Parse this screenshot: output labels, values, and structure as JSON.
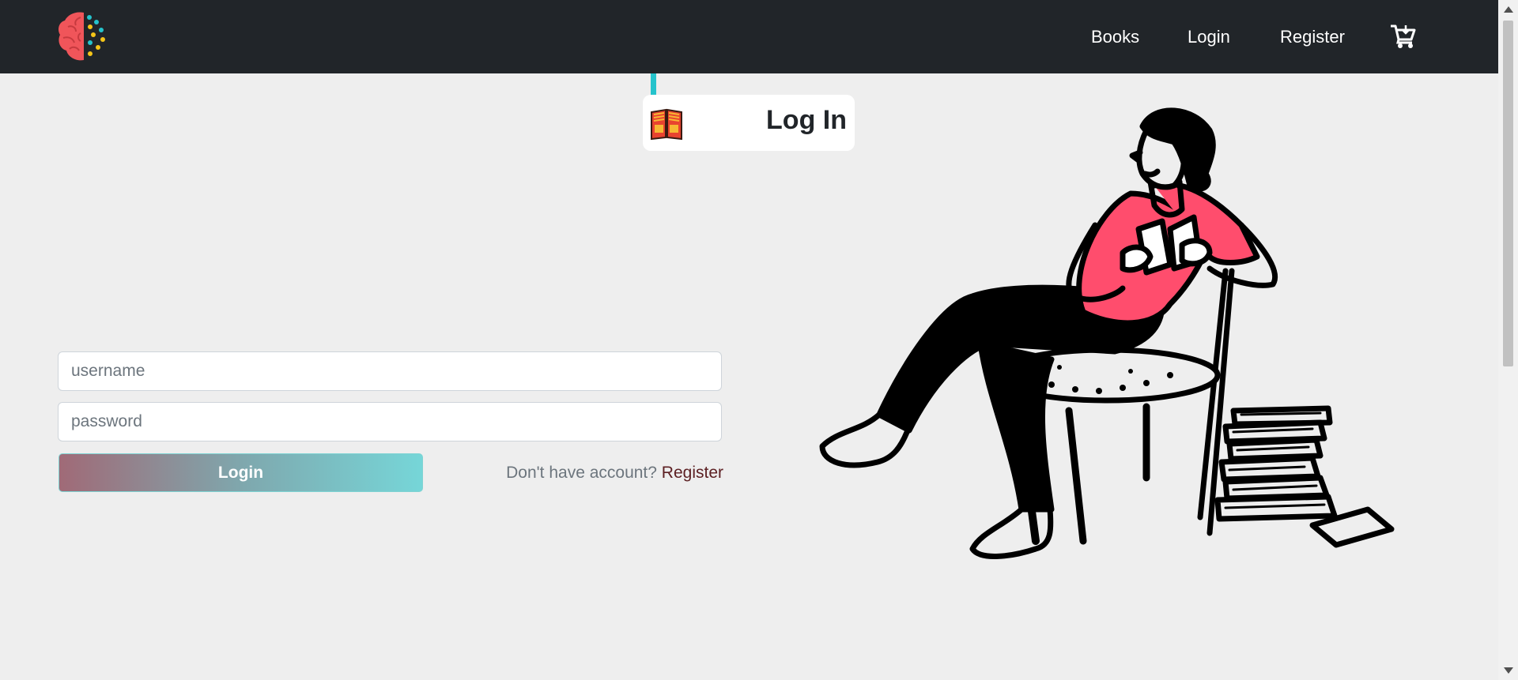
{
  "nav": {
    "logo_icon": "brain-logo-icon",
    "links": [
      "Books",
      "Login",
      "Register"
    ],
    "cart_icon": "shopping-cart-icon"
  },
  "hero": {
    "title": "Log In",
    "icon": "open-book-icon",
    "accent_color": "#25c3cc"
  },
  "form": {
    "username_placeholder": "username",
    "password_placeholder": "password",
    "login_label": "Login",
    "no_account_text": "Don't have account?",
    "register_link": "Register"
  },
  "illustration": {
    "icon": "woman-reading-on-chair-illustration",
    "shirt_color": "#ff4d6d"
  },
  "colors": {
    "navbar": "#212529",
    "background": "#eeeeee",
    "register_link": "#5c1f22"
  }
}
